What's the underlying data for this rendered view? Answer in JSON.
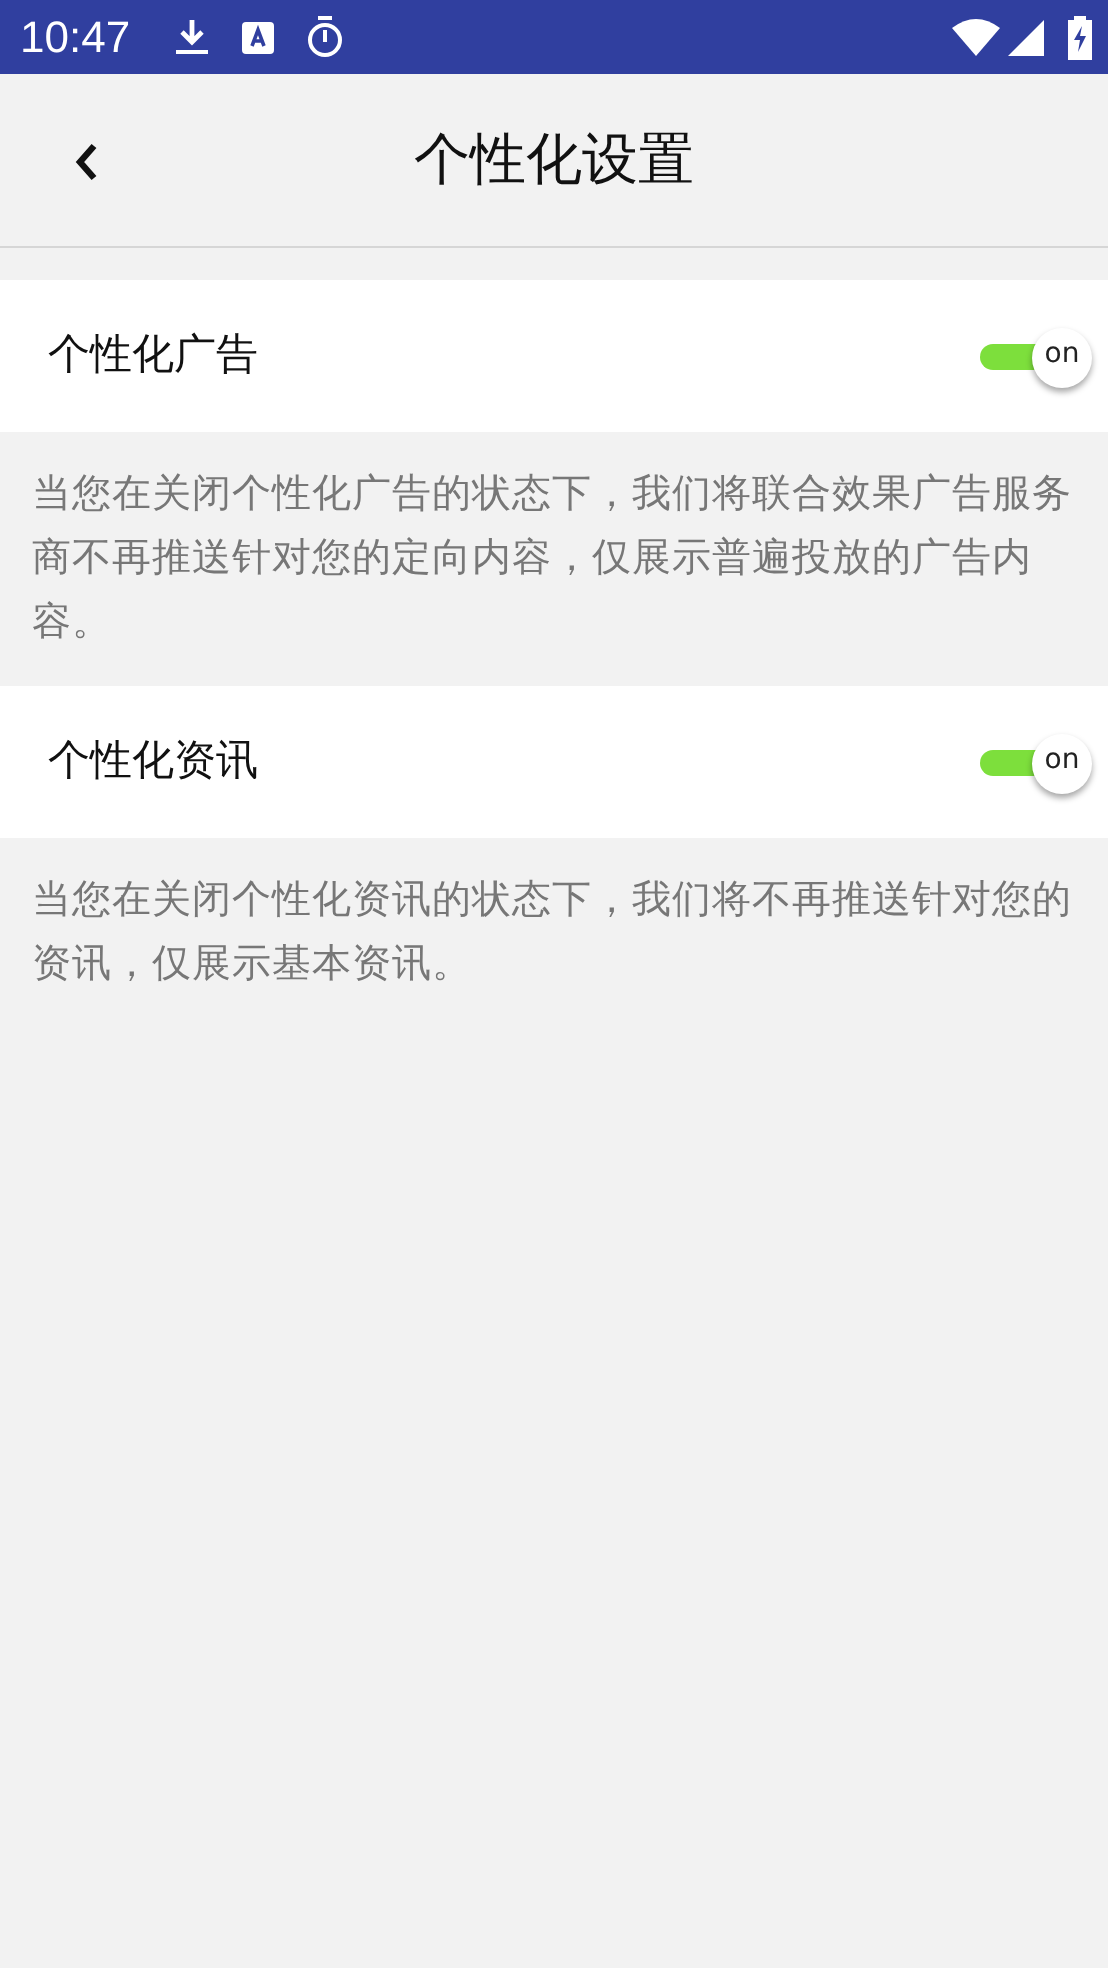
{
  "status_bar": {
    "time": "10:47"
  },
  "header": {
    "title": "个性化设置"
  },
  "settings": [
    {
      "label": "个性化广告",
      "on": true,
      "switch_text": "on",
      "description": "当您在关闭个性化广告的状态下，我们将联合效果广告服务商不再推送针对您的定向内容，仅展示普遍投放的广告内容。"
    },
    {
      "label": "个性化资讯",
      "on": true,
      "switch_text": "on",
      "description": "当您在关闭个性化资讯的状态下，我们将不再推送针对您的资讯，仅展示基本资讯。"
    }
  ]
}
